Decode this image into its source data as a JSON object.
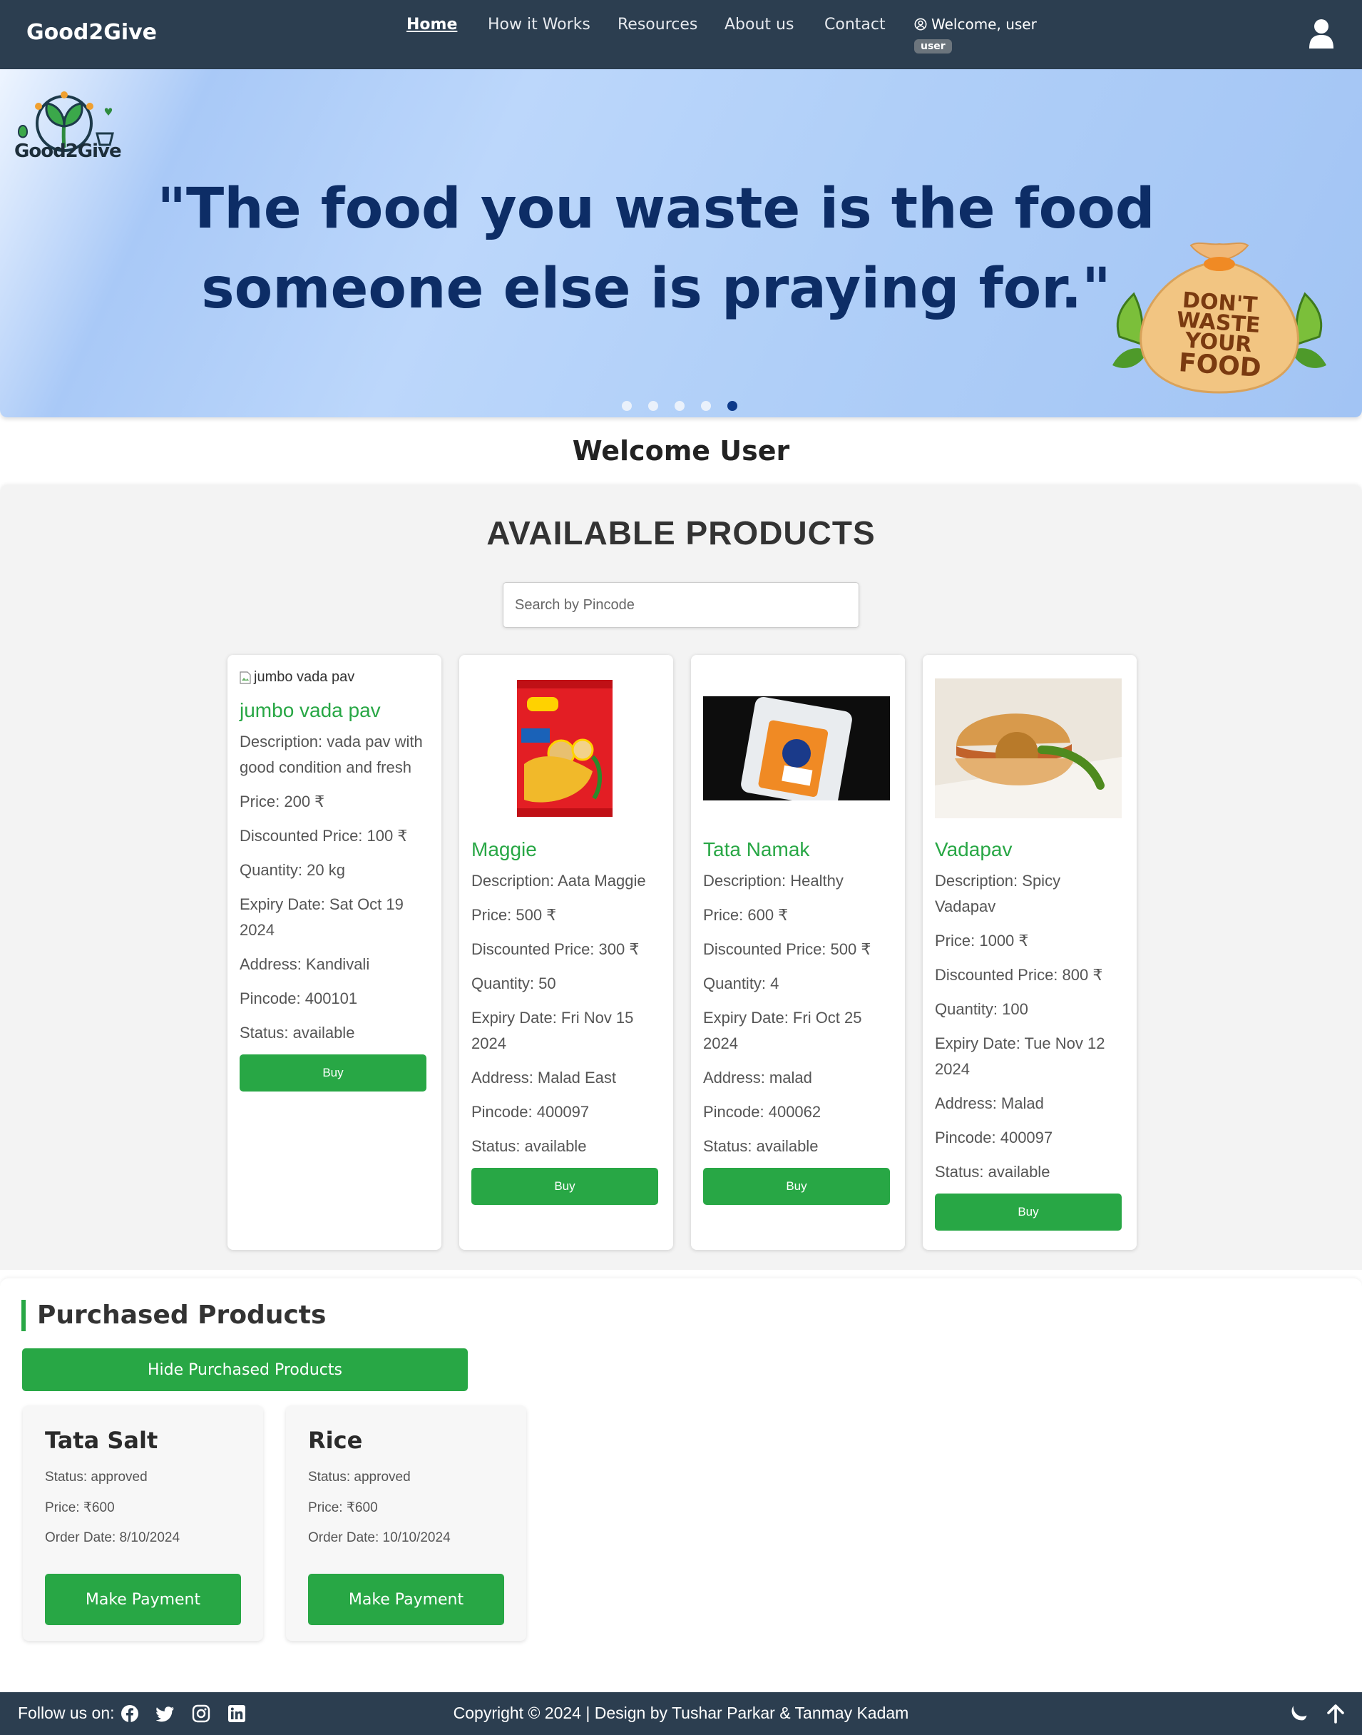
{
  "navbar": {
    "brand": "Good2Give",
    "links": [
      "Home",
      "How it Works",
      "Resources",
      "About us",
      "Contact"
    ],
    "welcome": "Welcome, user",
    "role_badge": "user"
  },
  "hero": {
    "logo_text": "Good2Give",
    "quote_line1": "\"The food you waste is the food",
    "quote_line2": "someone else is praying for.\"",
    "sack_text": [
      "DON'T",
      "WASTE",
      "YOUR",
      "FOOD"
    ],
    "slides": 5,
    "active_slide": 5
  },
  "welcome_heading": "Welcome User",
  "products": {
    "title": "AVAILABLE PRODUCTS",
    "search_placeholder": "Search by Pincode",
    "buy_label": "Buy",
    "items": [
      {
        "image_alt": "jumbo vada pav",
        "name": "jumbo vada pav",
        "description": "Description: vada pav with good condition and fresh",
        "price": "Price: 200 ₹",
        "discounted": "Discounted Price: 100 ₹",
        "quantity": "Quantity: 20 kg",
        "expiry": "Expiry Date: Sat Oct 19 2024",
        "address": "Address: Kandivali",
        "pincode": "Pincode: 400101",
        "status": "Status: available"
      },
      {
        "name": "Maggie",
        "description": "Description: Aata Maggie",
        "price": "Price: 500 ₹",
        "discounted": "Discounted Price: 300 ₹",
        "quantity": "Quantity: 50",
        "expiry": "Expiry Date: Fri Nov 15 2024",
        "address": "Address: Malad East",
        "pincode": "Pincode: 400097",
        "status": "Status: available"
      },
      {
        "name": "Tata Namak",
        "description": "Description: Healthy",
        "price": "Price: 600 ₹",
        "discounted": "Discounted Price: 500 ₹",
        "quantity": "Quantity: 4",
        "expiry": "Expiry Date: Fri Oct 25 2024",
        "address": "Address: malad",
        "pincode": "Pincode: 400062",
        "status": "Status: available"
      },
      {
        "name": "Vadapav",
        "description": "Description: Spicy Vadapav",
        "price": "Price: 1000 ₹",
        "discounted": "Discounted Price: 800 ₹",
        "quantity": "Quantity: 100",
        "expiry": "Expiry Date: Tue Nov 12 2024",
        "address": "Address: Malad",
        "pincode": "Pincode: 400097",
        "status": "Status: available"
      }
    ]
  },
  "purchased": {
    "title": "Purchased Products",
    "hide_label": "Hide Purchased Products",
    "pay_label": "Make Payment",
    "items": [
      {
        "name": "Tata Salt",
        "status": "Status: approved",
        "price": "Price: ₹600",
        "order_date": "Order Date: 8/10/2024"
      },
      {
        "name": "Rice",
        "status": "Status: approved",
        "price": "Price: ₹600",
        "order_date": "Order Date: 10/10/2024"
      }
    ]
  },
  "footer": {
    "follow": "Follow us on:",
    "social_icons": [
      "facebook-icon",
      "twitter-icon",
      "instagram-icon",
      "linkedin-icon"
    ],
    "copyright": "Copyright © 2024 | Design by Tushar Parkar & Tanmay Kadam"
  },
  "colors": {
    "navbar": "#2c3e50",
    "accent_green": "#28a745",
    "quote_blue": "#0d2d66",
    "page_bg": "#f3f3f3"
  }
}
